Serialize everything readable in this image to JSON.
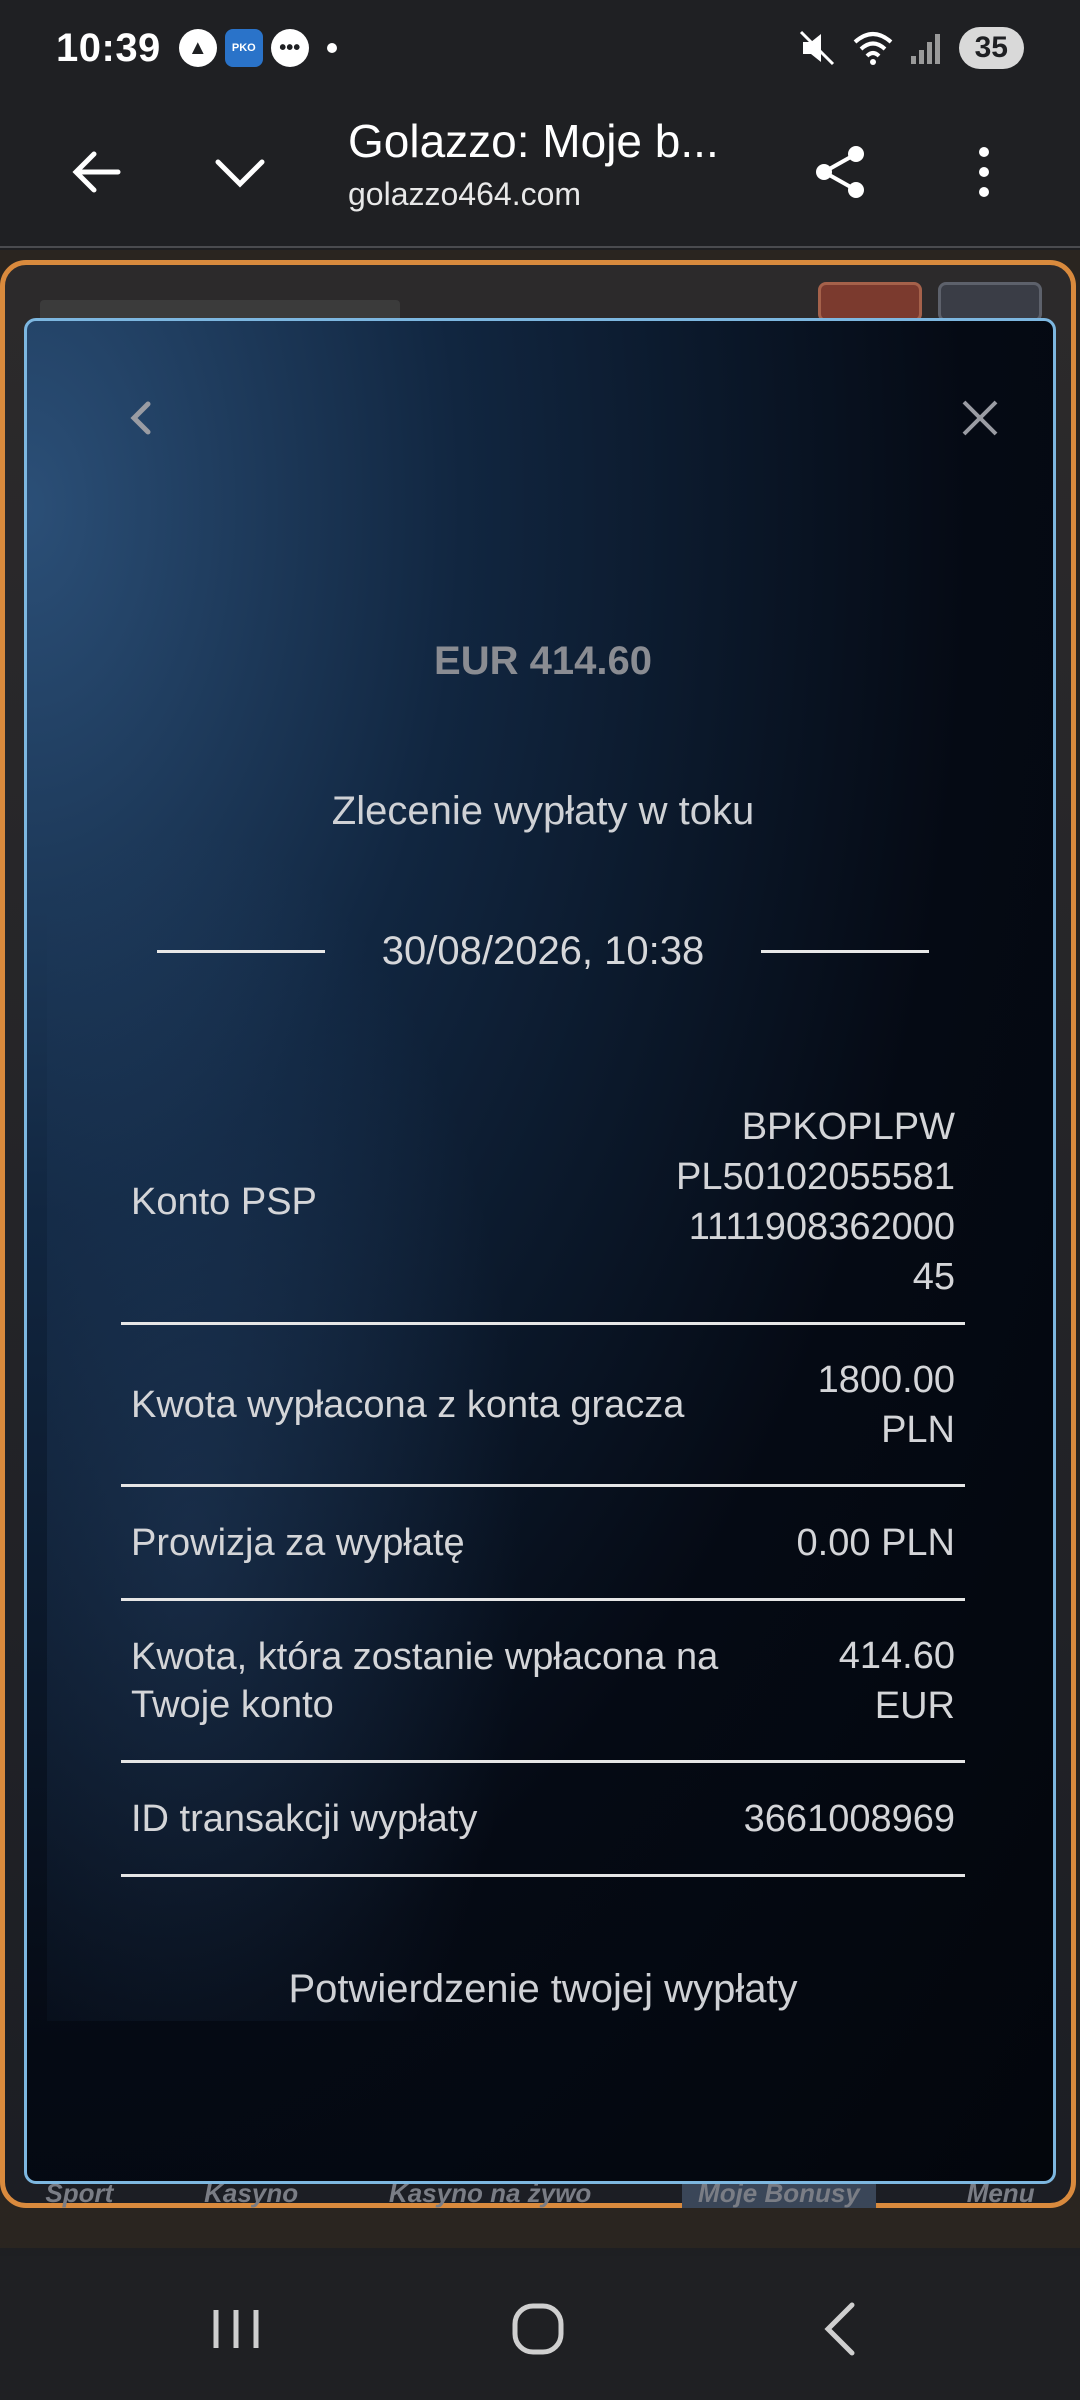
{
  "status_bar": {
    "time": "10:39",
    "battery": "35",
    "icons": [
      "app-notification-icon",
      "pko-app-icon",
      "chat-bubble-icon",
      "dot-icon",
      "mute-icon",
      "wifi-icon",
      "signal-icon"
    ]
  },
  "toolbar": {
    "title": "Golazzo: Moje b...",
    "url": "golazzo464.com"
  },
  "background_page": {
    "tabs": [
      "Sport",
      "Kasyno",
      "Kasyno na żywo",
      "Moje Bonusy",
      "Menu"
    ]
  },
  "modal": {
    "amount": "EUR 414.60",
    "status": "Zlecenie wypłaty w toku",
    "datetime": "30/08/2026, 10:38",
    "rows": [
      {
        "label": "Konto PSP",
        "value": "BPKOPLPW\nPL50102055581\n1111908362000\n45"
      },
      {
        "label": "Kwota wypłacona z konta gracza",
        "value": "1800.00\nPLN"
      },
      {
        "label": "Prowizja za wypłatę",
        "value": "0.00 PLN"
      },
      {
        "label": "Kwota, która zostanie wpłacona na Twoje konto",
        "value": "414.60\nEUR"
      },
      {
        "label": "ID transakcji wypłaty",
        "value": "3661008969"
      }
    ],
    "confirmation": "Potwierdzenie twojej wypłaty"
  }
}
